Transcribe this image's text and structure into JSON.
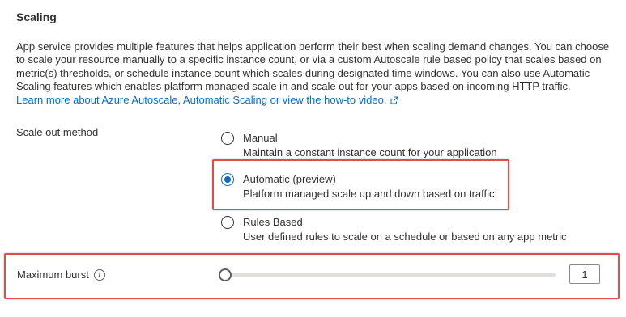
{
  "section": {
    "title": "Scaling"
  },
  "description": {
    "text": "App service provides multiple features that helps application perform their best when scaling demand changes. You can choose to scale your resource manually to a specific instance count, or via a custom Autoscale rule based policy that scales based on metric(s) thresholds, or schedule instance count which scales during designated time windows. You can also use Automatic Scaling features which enables platform managed scale in and scale out for your apps based on incoming HTTP traffic.",
    "link_text": "Learn more about Azure Autoscale, Automatic Scaling or view the how-to video."
  },
  "scale_out": {
    "label": "Scale out method",
    "selected": "automatic",
    "options": [
      {
        "id": "manual",
        "title": "Manual",
        "description": "Maintain a constant instance count for your application"
      },
      {
        "id": "automatic",
        "title": "Automatic (preview)",
        "description": "Platform managed scale up and down based on traffic"
      },
      {
        "id": "rules",
        "title": "Rules Based",
        "description": "User defined rules to scale on a schedule or based on any app metric"
      }
    ]
  },
  "max_burst": {
    "label": "Maximum burst",
    "value": "1",
    "slider_fraction": 0
  },
  "colors": {
    "accent": "#0f6cbd",
    "highlight": "#e24c4c"
  },
  "icons": {
    "external_link": "external-link-icon",
    "info": "info-icon"
  }
}
